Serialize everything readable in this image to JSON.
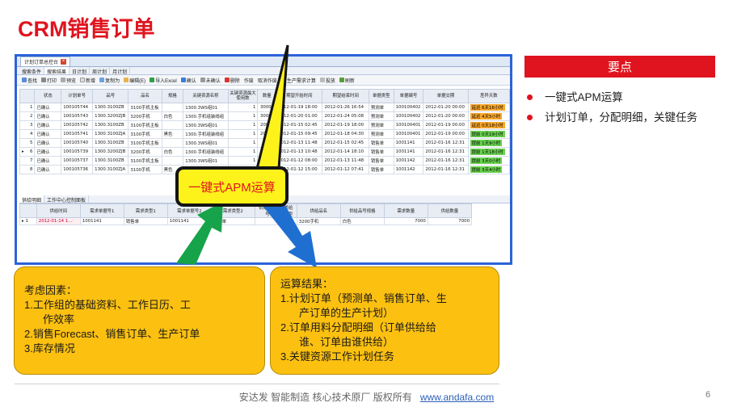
{
  "slide": {
    "title": "CRM销售订单",
    "page_number": "6"
  },
  "app": {
    "window_tab": "计划订单总控台",
    "subtabs": [
      "搜索条件",
      "搜索结果",
      "日计划",
      "周计划",
      "月计划"
    ],
    "toolbar": [
      "查找",
      "打印",
      "预览",
      "新增",
      "复制为",
      "编辑(E)",
      "导入Excel",
      "确认",
      "未确认",
      "删除",
      "作废",
      "取消作废",
      "生产需求计算",
      "投放",
      "刷新"
    ],
    "columns": [
      "状态",
      "计划单号",
      "品号",
      "品名",
      "规格",
      "关键资源名称",
      "关键资源最大使用数",
      "数量",
      "期望开始时间",
      "期望结束时间",
      "单据类型",
      "单据编号",
      "单据交期",
      "差异天数"
    ],
    "rows": [
      {
        "n": "1",
        "status": "已确认",
        "plan": "100105744",
        "item": "1300.3100ZB",
        "name": "3100手机主板",
        "spec": "",
        "res": "1300.3WS组01",
        "max": "1",
        "qty": "30000",
        "start": "2012-01-19 18:00",
        "end": "2012-01-26 16:54",
        "type": "预测单",
        "doc": "100100402",
        "due": "2012-01-20 00:00",
        "diff": "延迟 6天16小时",
        "kind": "warn"
      },
      {
        "n": "2",
        "status": "已确认",
        "plan": "100105743",
        "item": "1300.3200ZJB",
        "name": "3200手机",
        "spec": "白色",
        "res": "1300.手机组装线组",
        "max": "1",
        "qty": "30000",
        "start": "2012-01-20 01:00",
        "end": "2012-01-24 05:08",
        "type": "预测单",
        "doc": "100100402",
        "due": "2012-01-20 00:00",
        "diff": "延迟 4天5小时",
        "kind": "warn"
      },
      {
        "n": "3",
        "status": "已确认",
        "plan": "100105742",
        "item": "1300.3100ZB",
        "name": "3100手机主板",
        "spec": "",
        "res": "1300.3WS组01",
        "max": "1",
        "qty": "20000",
        "start": "2012-01-15 02:45",
        "end": "2012-01-19 18:00",
        "type": "预测单",
        "doc": "100100401",
        "due": "2012-01-19 00:00",
        "diff": "延迟 0天18小时",
        "kind": "warn"
      },
      {
        "n": "4",
        "status": "已确认",
        "plan": "100105741",
        "item": "1300.3100ZJA",
        "name": "3100手机",
        "spec": "黑色",
        "res": "1300.手机组装线组",
        "max": "1",
        "qty": "20000",
        "start": "2012-01-15 09:45",
        "end": "2012-01-18 04:30",
        "type": "预测单",
        "doc": "100100401",
        "due": "2012-01-19 00:00",
        "diff": "提前 0天19小时",
        "kind": "ok"
      },
      {
        "n": "5",
        "status": "已确认",
        "plan": "100105740",
        "item": "1300.3100ZB",
        "name": "3100手机主板",
        "spec": "",
        "res": "1300.3WS组01",
        "max": "1",
        "qty": "",
        "start": "2012-01-13 11:48",
        "end": "2012-01-15 02:45",
        "type": "销售单",
        "doc": "1001141",
        "due": "2012-01-16 12:31",
        "diff": "提前 1天9小时",
        "kind": "ok"
      },
      {
        "n": "6",
        "status": "已确认",
        "plan": "100105739",
        "item": "1300.3200ZJB",
        "name": "3200手机",
        "spec": "白色",
        "res": "1300.手机组装线组",
        "max": "1",
        "qty": "",
        "start": "2012-01-13 10:48",
        "end": "2012-01-14 18:10",
        "type": "销售单",
        "doc": "1001141",
        "due": "2012-01-16 12:31",
        "diff": "提前 1天18小时",
        "kind": "ok"
      },
      {
        "n": "7",
        "status": "已确认",
        "plan": "100105737",
        "item": "1300.3100ZB",
        "name": "3100手机主板",
        "spec": "",
        "res": "1300.3WS组01",
        "max": "1",
        "qty": "",
        "start": "2012-01-12 08:00",
        "end": "2012-01-13 11:48",
        "type": "销售单",
        "doc": "1001142",
        "due": "2012-01-16 12:31",
        "diff": "提前 3天0小时",
        "kind": "ok"
      },
      {
        "n": "8",
        "status": "已确认",
        "plan": "100105736",
        "item": "1300.3100ZJA",
        "name": "3100手机",
        "spec": "黑色",
        "res": "1300.手机组装线组",
        "max": "1",
        "qty": "",
        "start": "2012-01-12 15:00",
        "end": "2012-01-12 07:41",
        "type": "销售单",
        "doc": "1001142",
        "due": "2012-01-16 12:31",
        "diff": "提前 3天4小时",
        "kind": "ok"
      }
    ],
    "lower_tabs": [
      "供给明细",
      "工作中心控制面板"
    ],
    "lower_columns": [
      "供给时间",
      "需求单据号1",
      "需求类型1",
      "需求单据号2",
      "需求类型2",
      "供给单据号",
      "供给类型",
      "供给品名",
      "供给品号规格",
      "需求数量",
      "供给数量"
    ],
    "lower_row": {
      "n": "1",
      "time": "2012-01-14 1...",
      "doc1": "1001141",
      "type1": "销售单",
      "doc2": "1001141",
      "type2": "销售单",
      "sdoc": "",
      "stype": "",
      "sname": "3200手机",
      "sspec": "白色",
      "dq": "7000",
      "sq": "7000"
    }
  },
  "callout": "一键式APM运算",
  "box_left": {
    "heading": "考虑因素：",
    "lines": [
      "1.工作组的基础资料、工作日历、工",
      "作效率",
      "2.销售Forecast、销售订单、生产订单",
      "3.库存情况"
    ]
  },
  "box_right": {
    "heading": "运算结果：",
    "lines": [
      "1.计划订单（预测单、销售订单、生",
      "产订单的生产计划）",
      "2.订单用料分配明细（订单供给给",
      "谁、订单由谁供给）",
      "3.关键资源工作计划任务"
    ]
  },
  "key_points": {
    "header": "要点",
    "items": [
      "一键式APM运算",
      "计划订单，分配明细，关键任务"
    ]
  },
  "footer": {
    "text": "安达发  智能制造 核心技术原厂   版权所有",
    "link": "www.andafa.com"
  },
  "colors": {
    "accent": "#e0141e",
    "frame": "#2b63d9",
    "box": "#fcc010",
    "callout": "#fdf21a"
  }
}
